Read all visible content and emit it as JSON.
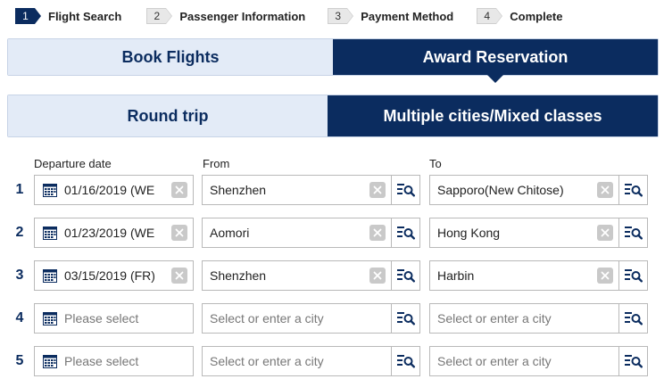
{
  "steps": [
    {
      "num": "1",
      "label": "Flight Search"
    },
    {
      "num": "2",
      "label": "Passenger Information"
    },
    {
      "num": "3",
      "label": "Payment Method"
    },
    {
      "num": "4",
      "label": "Complete"
    }
  ],
  "booking_tabs": {
    "book": "Book Flights",
    "award": "Award Reservation"
  },
  "trip_tabs": {
    "round": "Round trip",
    "multi": "Multiple cities/Mixed classes"
  },
  "columns": {
    "date": "Departure date",
    "from": "From",
    "to": "To"
  },
  "rows": [
    {
      "num": "1",
      "date": "01/16/2019 (WE",
      "from": "Shenzhen",
      "to": "Sapporo(New Chitose)"
    },
    {
      "num": "2",
      "date": "01/23/2019 (WE",
      "from": "Aomori",
      "to": "Hong Kong"
    },
    {
      "num": "3",
      "date": "03/15/2019 (FR)",
      "from": "Shenzhen",
      "to": "Harbin"
    },
    {
      "num": "4",
      "date_placeholder": "Please select",
      "from_placeholder": "Select or enter a city",
      "to_placeholder": "Select or enter a city"
    },
    {
      "num": "5",
      "date_placeholder": "Please select",
      "from_placeholder": "Select or enter a city",
      "to_placeholder": "Select or enter a city"
    }
  ],
  "colors": {
    "primary": "#0b2c5f",
    "tab_inactive": "#e3ebf7",
    "clear_button": "#c9c9c9"
  }
}
